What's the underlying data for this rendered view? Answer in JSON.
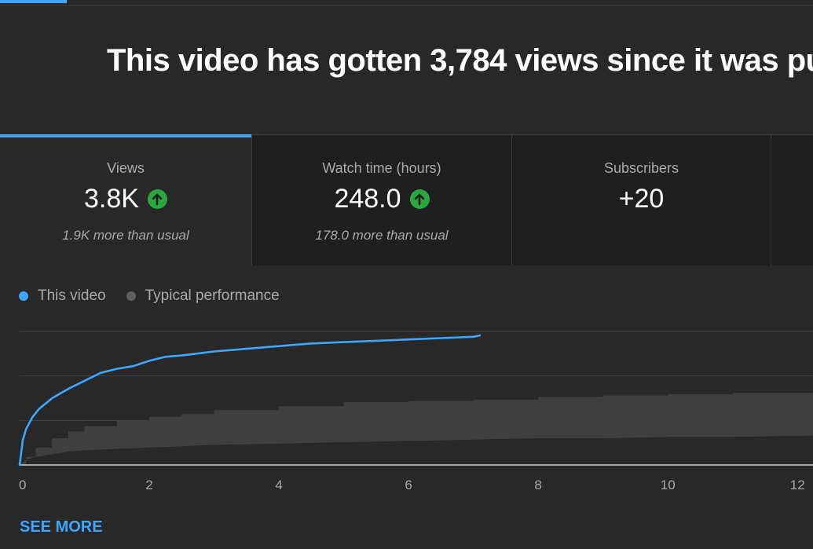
{
  "headline": "This video has gotten 3,784 views since it was pu",
  "metrics": [
    {
      "title": "Views",
      "value": "3.8K",
      "sub": "1.9K more than usual",
      "trend_icon": "arrow-up-icon"
    },
    {
      "title": "Watch time (hours)",
      "value": "248.0",
      "sub": "178.0 more than usual",
      "trend_icon": "arrow-up-icon"
    },
    {
      "title": "Subscribers",
      "value": "+20"
    }
  ],
  "legend": {
    "this_video": "This video",
    "typical": "Typical performance"
  },
  "colors": {
    "accent": "#3ea6ff",
    "this_video_line": "#3ea6ff",
    "typical_band": "#3f3f3f",
    "up_badge": "#2ba640",
    "background": "#282828"
  },
  "see_more": "SEE MORE",
  "chart_data": {
    "type": "line",
    "x_ticks": [
      "0",
      "2",
      "4",
      "6",
      "8",
      "10",
      "12"
    ],
    "xlim": [
      0,
      12.3
    ],
    "grid": true,
    "series": [
      {
        "name": "This video",
        "x": [
          0,
          0.05,
          0.1,
          0.2,
          0.3,
          0.5,
          0.75,
          1.0,
          1.25,
          1.5,
          1.75,
          2.0,
          2.25,
          2.5,
          3.0,
          3.5,
          4.0,
          4.5,
          5.0,
          5.5,
          6.0,
          6.5,
          7.0,
          7.1
        ],
        "y": [
          0,
          0.19,
          0.27,
          0.36,
          0.42,
          0.5,
          0.57,
          0.63,
          0.69,
          0.72,
          0.74,
          0.78,
          0.81,
          0.82,
          0.85,
          0.87,
          0.89,
          0.91,
          0.92,
          0.93,
          0.94,
          0.95,
          0.96,
          0.97
        ]
      },
      {
        "name": "Typical performance",
        "band": true,
        "x": [
          0,
          0.1,
          0.25,
          0.5,
          0.75,
          1.0,
          1.5,
          2.0,
          2.5,
          3.0,
          4.0,
          5.0,
          6.0,
          7.0,
          8.0,
          9.0,
          10.0,
          11.0,
          12.3
        ],
        "upper": [
          0,
          0.06,
          0.13,
          0.2,
          0.25,
          0.29,
          0.33,
          0.36,
          0.38,
          0.41,
          0.44,
          0.47,
          0.48,
          0.49,
          0.51,
          0.52,
          0.53,
          0.54,
          0.55
        ],
        "lower": [
          0,
          0.04,
          0.06,
          0.08,
          0.1,
          0.11,
          0.12,
          0.13,
          0.14,
          0.15,
          0.16,
          0.17,
          0.18,
          0.19,
          0.2,
          0.2,
          0.21,
          0.21,
          0.22
        ]
      }
    ]
  }
}
